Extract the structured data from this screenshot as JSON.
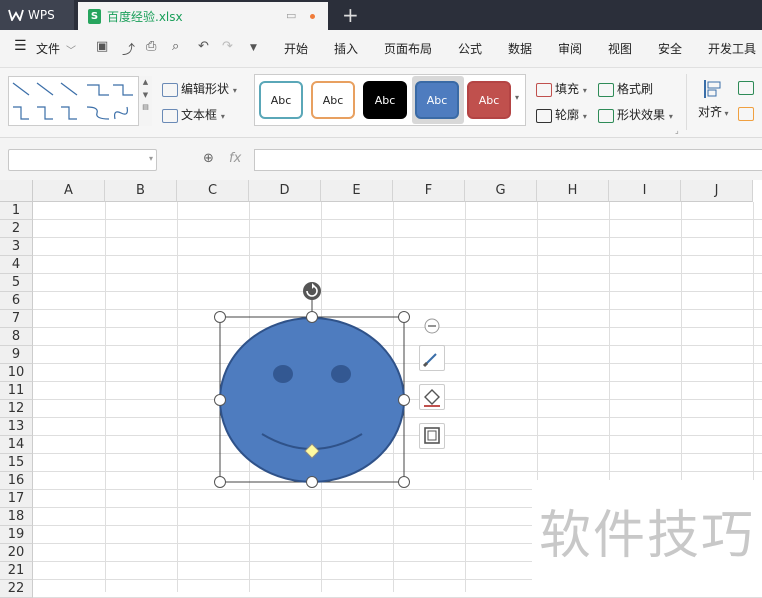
{
  "app": {
    "logo_label": "WPS",
    "doc_tab": "百度经验.xlsx",
    "file_badge": "S",
    "new_tab": "+"
  },
  "menu": {
    "file": "文件",
    "items": [
      "开始",
      "插入",
      "页面布局",
      "公式",
      "数据",
      "审阅",
      "视图",
      "安全",
      "开发工具"
    ]
  },
  "ribbon": {
    "edit_shape": "编辑形状",
    "text_box": "文本框",
    "fill": "填充",
    "outline": "轮廓",
    "format_painter": "格式刷",
    "shape_effects": "形状效果",
    "align": "对齐",
    "style_label": "Abc",
    "styles": [
      {
        "label": "Abc",
        "border": "#5aa7b8",
        "bg": "#ffffff",
        "color": "#222222"
      },
      {
        "label": "Abc",
        "border": "#e8a060",
        "bg": "#ffffff",
        "color": "#222222"
      },
      {
        "label": "Abc",
        "border": "#000000",
        "bg": "#000000",
        "color": "#ffffff"
      },
      {
        "label": "Abc",
        "border": "#3a6aa5",
        "bg": "#4e7cbf",
        "color": "#ffffff"
      },
      {
        "label": "Abc",
        "border": "#b44444",
        "bg": "#c0504d",
        "color": "#ffffff"
      }
    ]
  },
  "formula": {
    "fx": "fx",
    "name_value": "",
    "formula_value": ""
  },
  "sheet": {
    "columns": [
      "A",
      "B",
      "C",
      "D",
      "E",
      "F",
      "G",
      "H",
      "I",
      "J"
    ],
    "rows": [
      "1",
      "2",
      "3",
      "4",
      "5",
      "6",
      "7",
      "8",
      "9",
      "10",
      "11",
      "12",
      "13",
      "14",
      "15",
      "16",
      "17",
      "18",
      "19",
      "20",
      "21",
      "22"
    ]
  },
  "shape": {
    "fill": "#4e7cbf",
    "stroke": "#2f5289",
    "handle_color": "#ffffff",
    "adjust_color": "#fffaa0"
  },
  "watermark": "软件技巧"
}
